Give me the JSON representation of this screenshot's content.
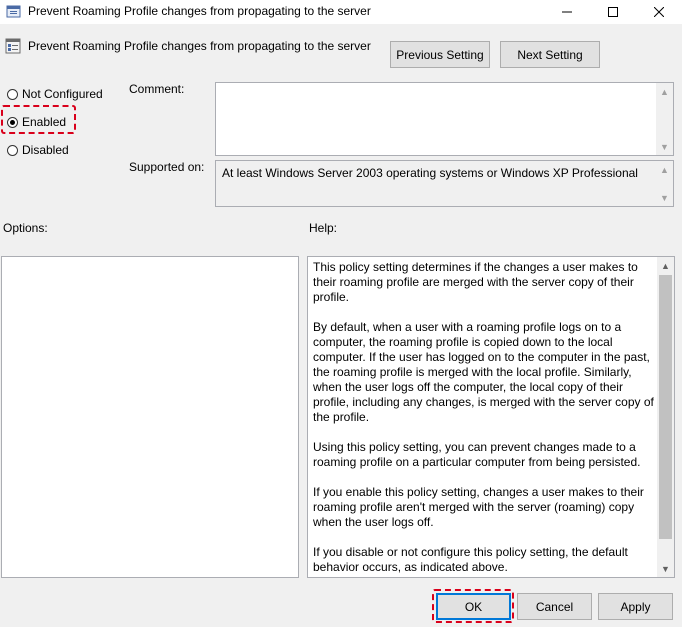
{
  "window": {
    "title": "Prevent Roaming Profile changes from propagating to the server",
    "icon": "policy-icon",
    "controls": [
      "minimize-icon",
      "maximize-icon",
      "close-icon"
    ]
  },
  "header": {
    "title": "Prevent Roaming Profile changes from propagating to the server",
    "prev_label": "Previous Setting",
    "next_label": "Next Setting"
  },
  "state": {
    "options": [
      {
        "label": "Not Configured",
        "selected": false
      },
      {
        "label": "Enabled",
        "selected": true
      },
      {
        "label": "Disabled",
        "selected": false
      }
    ],
    "highlight_color": "#d9001b"
  },
  "comment": {
    "label": "Comment:",
    "value": ""
  },
  "supported": {
    "label": "Supported on:",
    "value": "At least Windows Server 2003 operating systems or Windows XP Professional"
  },
  "options_panel": {
    "label": "Options:"
  },
  "help": {
    "label": "Help:",
    "paragraphs": [
      "This policy setting determines if the changes a user makes to their roaming profile are merged with the server copy of their profile.",
      "By default, when a user with a roaming profile logs on to a computer, the roaming profile is copied down to the local computer. If the user has logged on to the computer in the past, the roaming profile is merged with the local profile. Similarly, when the user logs off the computer, the local copy of their profile, including any changes, is merged with the server copy of the profile.",
      "Using this policy setting, you can prevent changes made to a roaming profile on a particular computer from being persisted.",
      "If you enable this policy setting, changes a user makes to their roaming profile aren't merged with the server (roaming) copy when the user logs off.",
      "If you disable or not configure this policy setting, the default behavior occurs, as indicated above."
    ]
  },
  "footer": {
    "ok_label": "OK",
    "cancel_label": "Cancel",
    "apply_label": "Apply",
    "accent": "#0078d7"
  }
}
